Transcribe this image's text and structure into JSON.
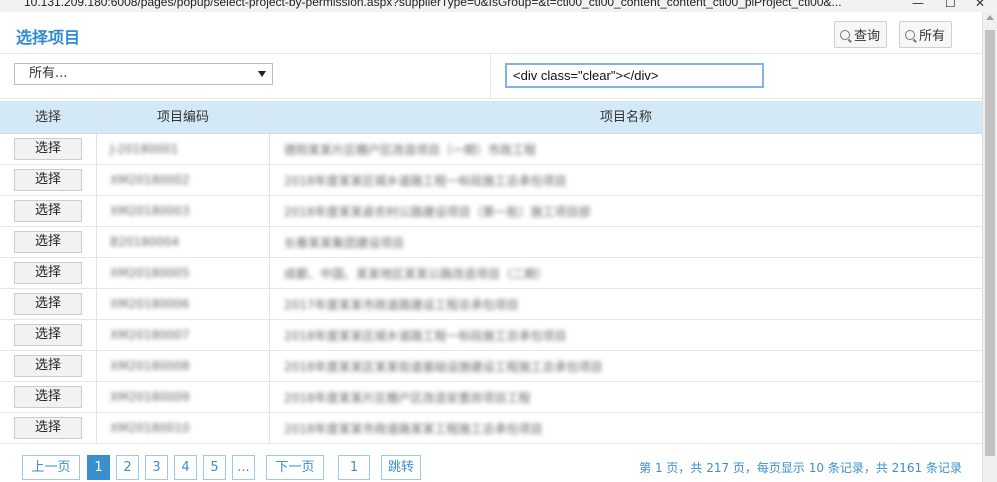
{
  "window": {
    "url": "10.131.209.180:6008/pages/popup/select-project-by-permission.aspx?supplierType=0&IsGroup=&t=ctl00_ctl00_content_content_ctl00_plProject_ctl00&...",
    "minimize_icon": "minimize-icon",
    "maximize_icon": "maximize-icon",
    "close_icon": "close-icon"
  },
  "header": {
    "title": "选择项目",
    "query_label": "查询",
    "all_label": "所有"
  },
  "filters": {
    "select_value": "所有...",
    "text_value": "<div class=\"clear\"></div>"
  },
  "table": {
    "columns": [
      "选择",
      "项目编码",
      "项目名称"
    ],
    "button_label": "选择",
    "rows": [
      {
        "code": "J-20180001",
        "name": "德阳某某片区棚户区改造项目（一期）市政工程"
      },
      {
        "code": "XM20180002",
        "name": "2018年度某某区城乡道路工程一标段施工总承包项目"
      },
      {
        "code": "XM20180003",
        "name": "2018年度某某县农村公路建设项目（第一批）施工项目部"
      },
      {
        "code": "B20180004",
        "name": "长春某某集团建设项目"
      },
      {
        "code": "XM20180005",
        "name": "成都、中国、某某地区某某公路改造项目（二期）"
      },
      {
        "code": "XM20180006",
        "name": "2017年度某某市政道路建设工程总承包项目"
      },
      {
        "code": "XM20180007",
        "name": "2018年度某某区城乡道路工程一标段施工总承包项目"
      },
      {
        "code": "XM20180008",
        "name": "2018年度某某区某某街道基础设施建设工程施工总承包项目"
      },
      {
        "code": "XM20180009",
        "name": "2018年度某某片区棚户区改造安置房项目工程"
      },
      {
        "code": "XM20180010",
        "name": "2018年度某某市政道路某某工程施工总承包项目"
      }
    ],
    "row_clear_text": "<div class=\"clear\"></div>"
  },
  "pager": {
    "prev": "上一页",
    "pages": [
      "1",
      "2",
      "3",
      "4",
      "5",
      "..."
    ],
    "current": "1",
    "next": "下一页",
    "jump_value": "1",
    "jump_label": "跳转",
    "info": "第 1 页，共 217 页，每页显示 10 条记录，共 2161 条记录"
  }
}
